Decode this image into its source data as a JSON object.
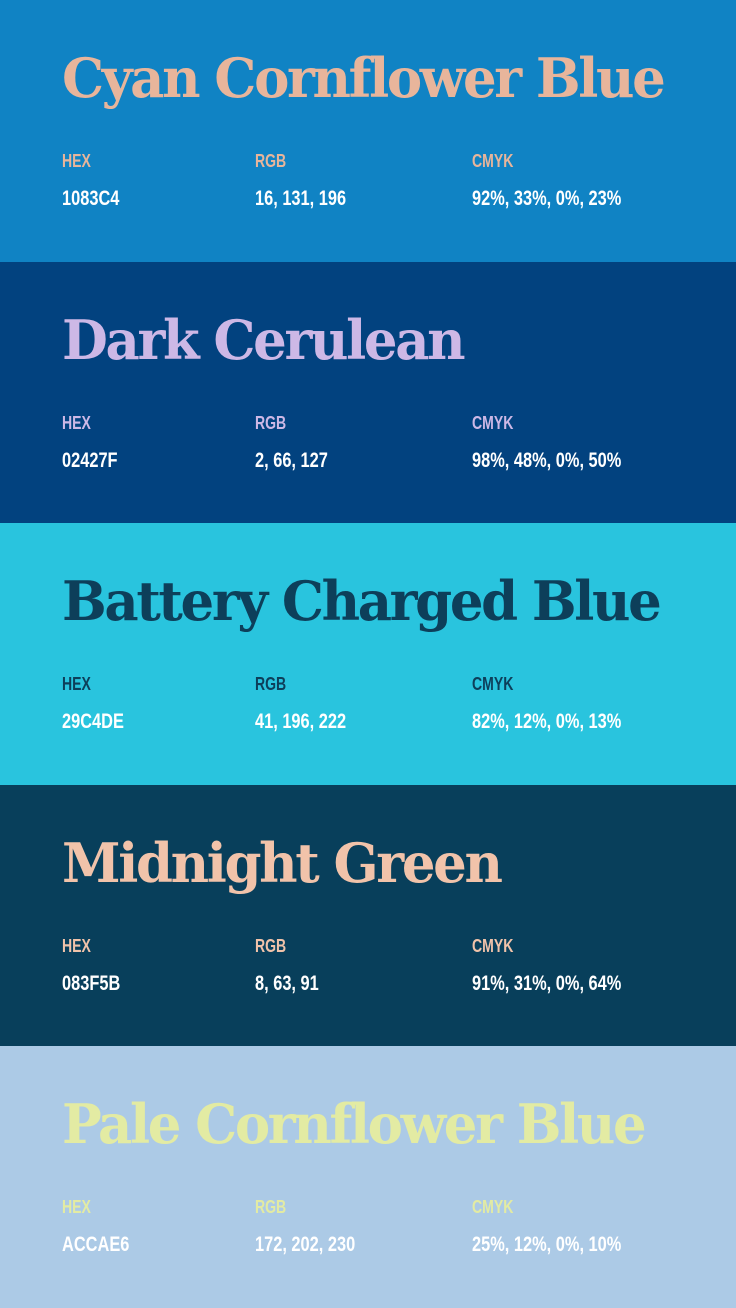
{
  "palette": [
    {
      "name": "Cyan Cornflower Blue",
      "bg_color": "#1083C4",
      "accent_color": "#E8B59B",
      "hex_label": "HEX",
      "hex": "1083C4",
      "rgb_label": "RGB",
      "rgb": "16, 131, 196",
      "cmyk_label": "CMYK",
      "cmyk": "92%, 33%, 0%, 23%"
    },
    {
      "name": "Dark Cerulean",
      "bg_color": "#02427F",
      "accent_color": "#CDB8E6",
      "hex_label": "HEX",
      "hex": "02427F",
      "rgb_label": "RGB",
      "rgb": "2, 66, 127",
      "cmyk_label": "CMYK",
      "cmyk": "98%, 48%, 0%, 50%"
    },
    {
      "name": "Battery Charged Blue",
      "bg_color": "#29C4DE",
      "accent_color": "#0D3F5A",
      "hex_label": "HEX",
      "hex": "29C4DE",
      "rgb_label": "RGB",
      "rgb": "41, 196, 222",
      "cmyk_label": "CMYK",
      "cmyk": "82%, 12%, 0%, 13%"
    },
    {
      "name": "Midnight Green",
      "bg_color": "#083F5B",
      "accent_color": "#F1C3AA",
      "hex_label": "HEX",
      "hex": "083F5B",
      "rgb_label": "RGB",
      "rgb": "8, 63, 91",
      "cmyk_label": "CMYK",
      "cmyk": "91%, 31%, 0%, 64%"
    },
    {
      "name": "Pale Cornflower Blue",
      "bg_color": "#ACCAE6",
      "accent_color": "#E3EBA3",
      "hex_label": "HEX",
      "hex": "ACCAE6",
      "rgb_label": "RGB",
      "rgb": "172, 202, 230",
      "cmyk_label": "CMYK",
      "cmyk": "25%, 12%, 0%, 10%"
    }
  ]
}
